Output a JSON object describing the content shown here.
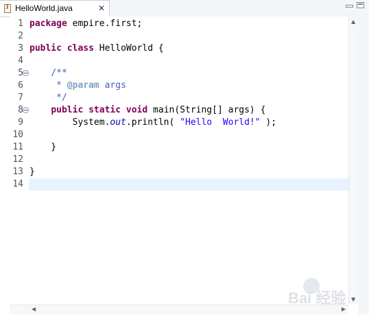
{
  "tab": {
    "title": "HelloWorld.java",
    "close": "✕",
    "icon": "java-file-icon"
  },
  "window_controls": [
    "minimize-icon",
    "maximize-icon"
  ],
  "editor": {
    "current_line": 14,
    "lines": [
      {
        "n": "1",
        "text": "package empire.first;"
      },
      {
        "n": "2",
        "text": ""
      },
      {
        "n": "3",
        "text": "public class HelloWorld {"
      },
      {
        "n": "4",
        "text": ""
      },
      {
        "n": "5",
        "text": "    /**"
      },
      {
        "n": "6",
        "text": "     * @param args"
      },
      {
        "n": "7",
        "text": "     */"
      },
      {
        "n": "8",
        "text": "    public static void main(String[] args) {"
      },
      {
        "n": "9",
        "text": "        System.out.println( \"Hello  World!\" );"
      },
      {
        "n": "10",
        "text": ""
      },
      {
        "n": "11",
        "text": "    }"
      },
      {
        "n": "12",
        "text": ""
      },
      {
        "n": "13",
        "text": "}"
      },
      {
        "n": "14",
        "text": ""
      }
    ]
  },
  "watermark": {
    "text": "Bai 经验"
  },
  "colors": {
    "keyword": "#7f0055",
    "comment": "#3f5fbf",
    "javadoc_tag": "#7f9fbf",
    "string": "#2a00ff",
    "field": "#0000c0",
    "current_line": "#e8f2fe"
  }
}
